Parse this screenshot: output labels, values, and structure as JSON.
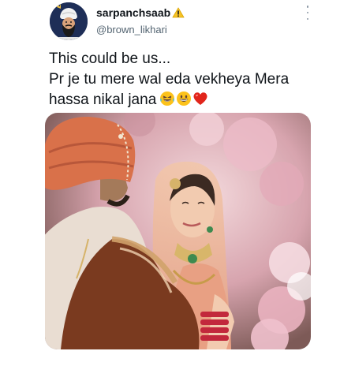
{
  "tweet": {
    "user": {
      "display_name": "sarpanchsaab",
      "badge_icon": "warning-icon",
      "handle": "@brown_likhari",
      "avatar_icon": "sikh-man-avatar"
    },
    "more_icon": "more-vertical-icon",
    "text_lines": [
      "This could be us...",
      "Pr je tu mere wal eda vekheya Mera",
      "hassa nikal jana"
    ],
    "emojis": [
      "laughing-tears-emoji",
      "grinning-emoji",
      "red-heart-emoji"
    ],
    "media": {
      "type": "photo",
      "subject": "bride-and-groom-photo"
    },
    "colors": {
      "text": "#0f1419",
      "secondary": "#536471",
      "avatar_bg": "#1e2e57",
      "turban": "#d9714a",
      "bride_dress": "#e8a083",
      "background_blossom": "#e9b6c4"
    }
  }
}
